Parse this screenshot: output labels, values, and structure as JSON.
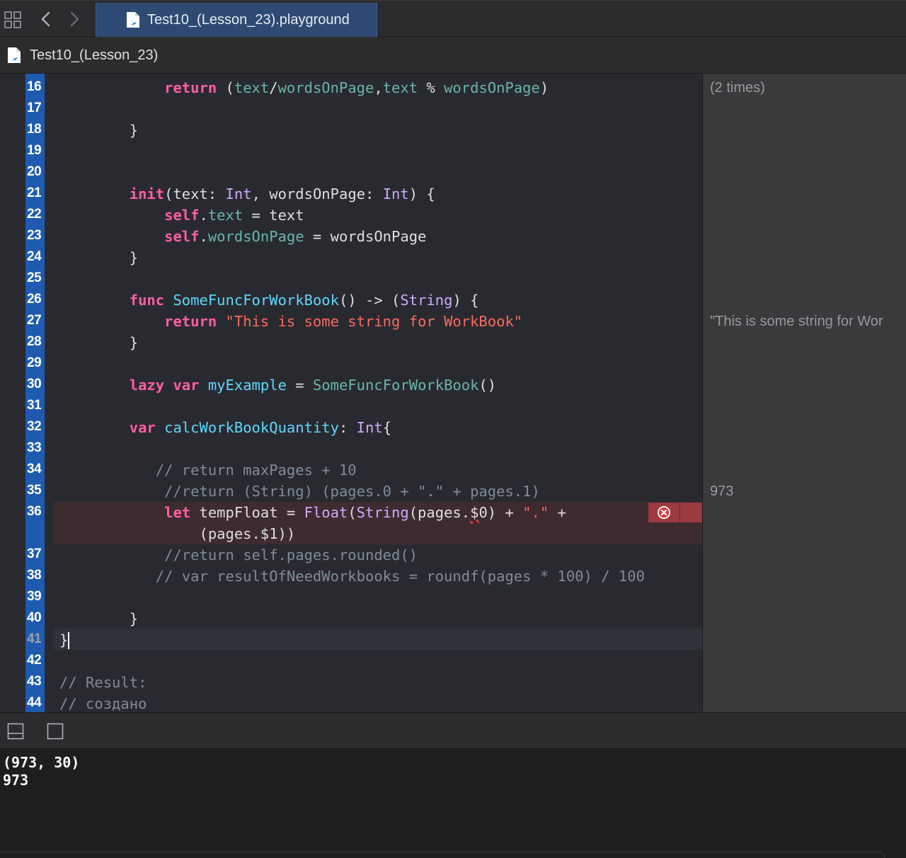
{
  "window": {
    "tab_title": "Test10_(Lesson_23).playground",
    "breadcrumb": "Test10_(Lesson_23)"
  },
  "icons": {
    "grid": "grid-icon",
    "back": "chevron-left-icon",
    "forward": "chevron-right-icon",
    "file": "swift-file-icon",
    "error": "error-circle-icon",
    "hide_debug": "hide-debug-area-icon",
    "console_toggle": "console-toggle-icon"
  },
  "colors": {
    "keyword": "#fc5fa3",
    "type": "#d0a8ff",
    "property": "#67b7a4",
    "function": "#5dd8ff",
    "string": "#fc6a5d",
    "comment": "#7f8c98",
    "run_bar": "#1e5bb0",
    "error": "#9b3a40"
  },
  "editor": {
    "lines": [
      {
        "n": "16",
        "tokens": [
          {
            "t": "            "
          },
          {
            "t": "return",
            "c": "k"
          },
          {
            "t": " ("
          },
          {
            "t": "text",
            "c": "p"
          },
          {
            "t": "/"
          },
          {
            "t": "wordsOnPage",
            "c": "p"
          },
          {
            "t": ","
          },
          {
            "t": "text",
            "c": "p"
          },
          {
            "t": " % "
          },
          {
            "t": "wordsOnPage",
            "c": "p"
          },
          {
            "t": ")"
          }
        ]
      },
      {
        "n": "17",
        "tokens": []
      },
      {
        "n": "18",
        "tokens": [
          {
            "t": "        }"
          }
        ]
      },
      {
        "n": "19",
        "tokens": []
      },
      {
        "n": "20",
        "tokens": []
      },
      {
        "n": "21",
        "tokens": [
          {
            "t": "        "
          },
          {
            "t": "init",
            "c": "k"
          },
          {
            "t": "(text: "
          },
          {
            "t": "Int",
            "c": "t"
          },
          {
            "t": ", wordsOnPage: "
          },
          {
            "t": "Int",
            "c": "t"
          },
          {
            "t": ") {"
          }
        ]
      },
      {
        "n": "22",
        "tokens": [
          {
            "t": "            "
          },
          {
            "t": "self",
            "c": "k"
          },
          {
            "t": "."
          },
          {
            "t": "text",
            "c": "p"
          },
          {
            "t": " = text"
          }
        ]
      },
      {
        "n": "23",
        "tokens": [
          {
            "t": "            "
          },
          {
            "t": "self",
            "c": "k"
          },
          {
            "t": "."
          },
          {
            "t": "wordsOnPage",
            "c": "p"
          },
          {
            "t": " = wordsOnPage"
          }
        ]
      },
      {
        "n": "24",
        "tokens": [
          {
            "t": "        }"
          }
        ]
      },
      {
        "n": "25",
        "tokens": []
      },
      {
        "n": "26",
        "tokens": [
          {
            "t": "        "
          },
          {
            "t": "func",
            "c": "k"
          },
          {
            "t": " "
          },
          {
            "t": "SomeFuncForWorkBook",
            "c": "f"
          },
          {
            "t": "() -> ("
          },
          {
            "t": "String",
            "c": "t"
          },
          {
            "t": ") {"
          }
        ]
      },
      {
        "n": "27",
        "tokens": [
          {
            "t": "            "
          },
          {
            "t": "return",
            "c": "k"
          },
          {
            "t": " "
          },
          {
            "t": "\"This is some string for WorkBook\"",
            "c": "s"
          }
        ]
      },
      {
        "n": "28",
        "tokens": [
          {
            "t": "        }"
          }
        ]
      },
      {
        "n": "29",
        "tokens": []
      },
      {
        "n": "30",
        "tokens": [
          {
            "t": "        "
          },
          {
            "t": "lazy",
            "c": "k"
          },
          {
            "t": " "
          },
          {
            "t": "var",
            "c": "k"
          },
          {
            "t": " "
          },
          {
            "t": "myExample",
            "c": "f"
          },
          {
            "t": " = "
          },
          {
            "t": "SomeFuncForWorkBook",
            "c": "p"
          },
          {
            "t": "()"
          }
        ]
      },
      {
        "n": "31",
        "tokens": []
      },
      {
        "n": "32",
        "tokens": [
          {
            "t": "        "
          },
          {
            "t": "var",
            "c": "k"
          },
          {
            "t": " "
          },
          {
            "t": "calcWorkBookQuantity",
            "c": "f"
          },
          {
            "t": ": "
          },
          {
            "t": "Int",
            "c": "t"
          },
          {
            "t": "{"
          }
        ]
      },
      {
        "n": "33",
        "tokens": []
      },
      {
        "n": "34",
        "tokens": [
          {
            "t": "           "
          },
          {
            "t": "// return maxPages + 10",
            "c": "c"
          }
        ]
      },
      {
        "n": "35",
        "tokens": [
          {
            "t": "            "
          },
          {
            "t": "//return (String) (pages.0 + \".\" + pages.1)",
            "c": "c"
          }
        ]
      },
      {
        "n": "36",
        "tokens": [
          {
            "t": "            "
          },
          {
            "t": "let",
            "c": "k"
          },
          {
            "t": " tempFloat = "
          },
          {
            "t": "Float",
            "c": "t"
          },
          {
            "t": "("
          },
          {
            "t": "String",
            "c": "t"
          },
          {
            "t": "(pages."
          },
          {
            "t": "$",
            "c": "sq"
          },
          {
            "t": "0) + "
          },
          {
            "t": "\".\"",
            "c": "s"
          },
          {
            "t": " +"
          }
        ]
      },
      {
        "n": "",
        "tokens": [
          {
            "t": "                (pages.$1))"
          }
        ]
      },
      {
        "n": "37",
        "tokens": [
          {
            "t": "            "
          },
          {
            "t": "//return self.pages.rounded()",
            "c": "c"
          }
        ]
      },
      {
        "n": "38",
        "tokens": [
          {
            "t": "           "
          },
          {
            "t": "// var resultOfNeedWorkbooks = roundf(pages * 100) / 100",
            "c": "c"
          }
        ]
      },
      {
        "n": "39",
        "tokens": []
      },
      {
        "n": "40",
        "tokens": [
          {
            "t": "        }"
          }
        ]
      },
      {
        "n": "41",
        "tokens": [
          {
            "t": "}"
          }
        ]
      },
      {
        "n": "42",
        "tokens": []
      },
      {
        "n": "43",
        "tokens": [
          {
            "t": "// Result:",
            "c": "c"
          }
        ]
      },
      {
        "n": "44",
        "tokens": [
          {
            "t": "// создано",
            "c": "c"
          }
        ]
      }
    ]
  },
  "results_sidebar": [
    {
      "line": "16",
      "text": "(2 times)"
    },
    {
      "line": "27",
      "text": "\"This is some string for Wor"
    },
    {
      "line": "35",
      "text": "973"
    }
  ],
  "console": {
    "lines": [
      "(973, 30)",
      "973"
    ]
  }
}
